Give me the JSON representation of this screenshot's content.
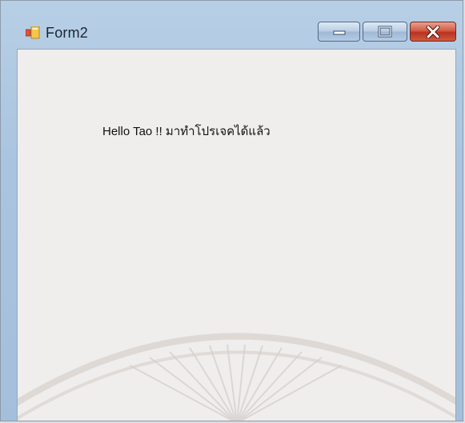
{
  "window": {
    "title": "Form2",
    "icon": "form-icon"
  },
  "controls": {
    "minimize_icon": "minimize-icon",
    "maximize_icon": "maximize-icon",
    "close_icon": "close-icon"
  },
  "form": {
    "label_text": "Hello Tao !! มาทำโปรเจคได้แล้ว"
  },
  "colors": {
    "title_bar": "#a9c4df",
    "client_bg": "#efeeec",
    "close_button": "#c8442c"
  }
}
